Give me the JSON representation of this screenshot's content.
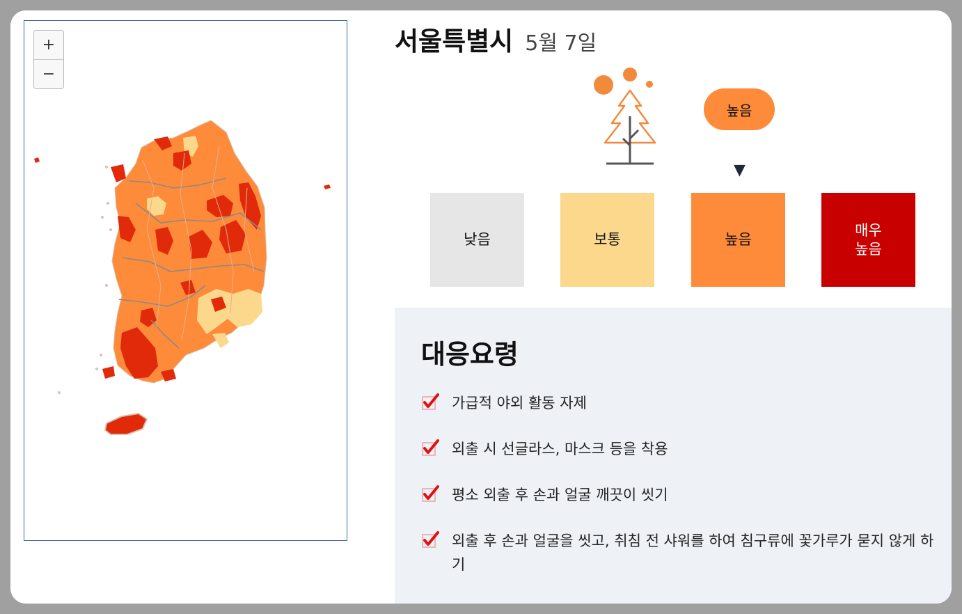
{
  "map": {
    "zoom_in_label": "+",
    "zoom_out_label": "−"
  },
  "header": {
    "region": "서울특별시",
    "date": "5월 7일"
  },
  "current_level": {
    "label": "높음",
    "color": "#fd8b3a",
    "icon": "pollen-tree-icon"
  },
  "levels": [
    {
      "label": "낮음",
      "color": "#e6e6e6",
      "text_color": "#111111"
    },
    {
      "label": "보통",
      "color": "#fbd88c",
      "text_color": "#111111"
    },
    {
      "label": "높음",
      "color": "#fd8b3a",
      "text_color": "#111111"
    },
    {
      "label": "매우\n높음",
      "color": "#c80000",
      "text_color": "#ffffff"
    }
  ],
  "response": {
    "title": "대응요령",
    "check_icon": "red-checkmark-icon",
    "items": [
      "가급적 야외 활동 자제",
      "외출 시 선글라스, 마스크 등을 착용",
      "평소 외출 후 손과 얼굴 깨끗이 씻기",
      "외출 후 손과 얼굴을 씻고, 취침 전 샤워를 하여 침구류에 꽃가루가 묻지 않게 하기"
    ]
  }
}
